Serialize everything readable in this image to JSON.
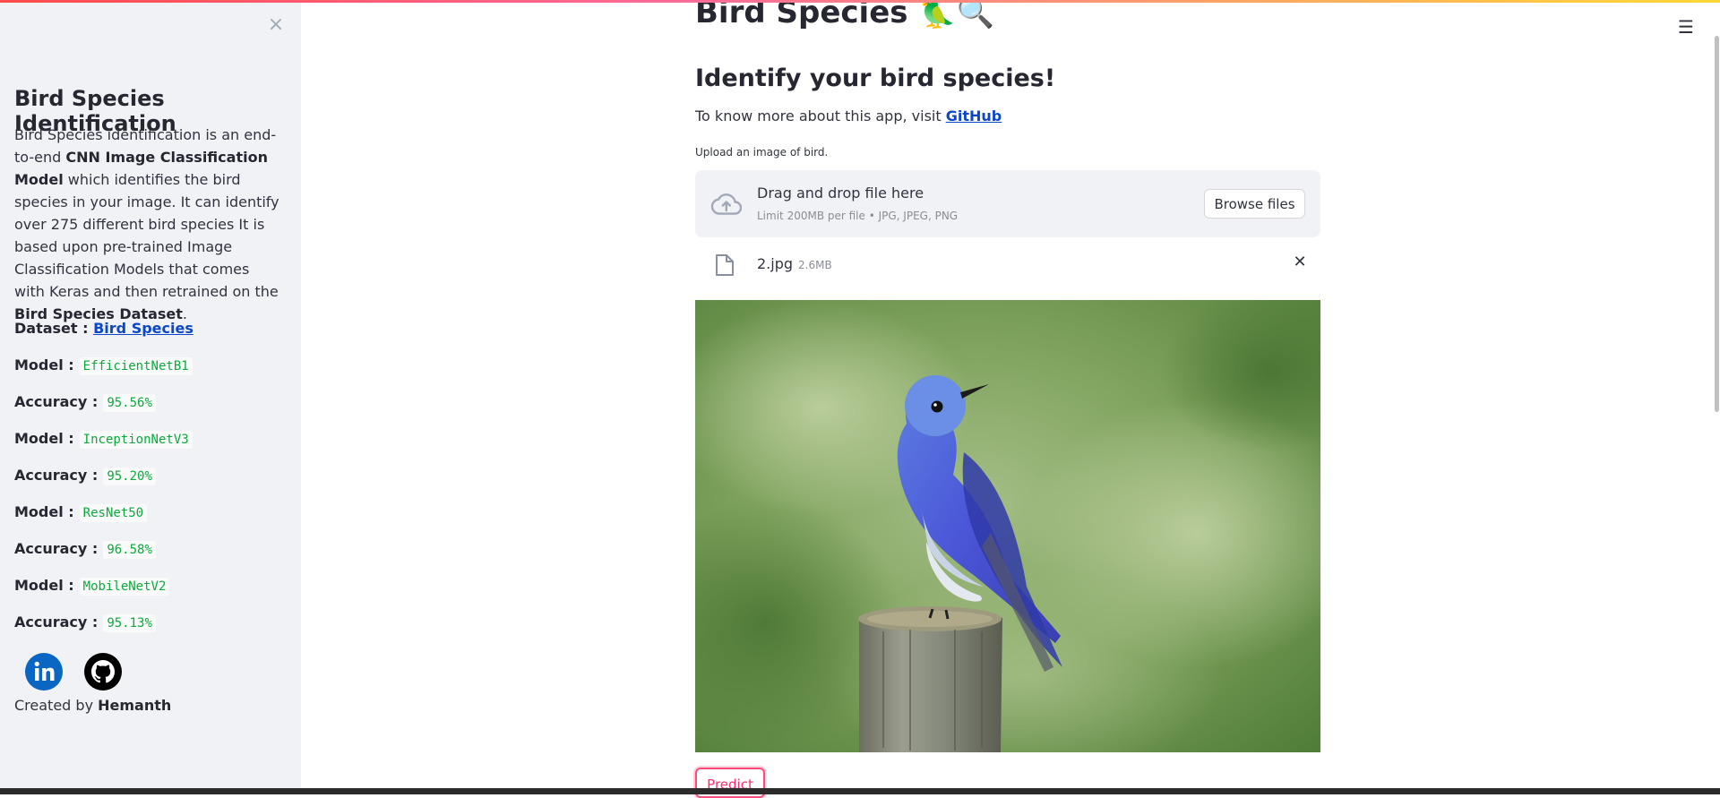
{
  "sidebar": {
    "close_label": "×",
    "title": "Bird Species Identification",
    "description_parts": {
      "p1": "Bird Species identification is an end-to-end ",
      "b1": "CNN Image Classification Model",
      "p2": " which identifies the bird species in your image. It can identify over 275 different bird species It is based upon pre-trained Image Classification Models that comes with Keras and then retrained on the ",
      "b2": "Bird Species Dataset",
      "p3": "."
    },
    "dataset_label": "Dataset :",
    "dataset_link": "Bird Species",
    "models": [
      {
        "model_label": "Model :",
        "model": "EfficientNetB1",
        "acc_label": "Accuracy :",
        "accuracy": "95.56%"
      },
      {
        "model_label": "Model :",
        "model": "InceptionNetV3",
        "acc_label": "Accuracy :",
        "accuracy": "95.20%"
      },
      {
        "model_label": "Model :",
        "model": "ResNet50",
        "acc_label": "Accuracy :",
        "accuracy": "96.58%"
      },
      {
        "model_label": "Model :",
        "model": "MobileNetV2",
        "acc_label": "Accuracy :",
        "accuracy": "95.13%"
      }
    ],
    "created_prefix": "Created by ",
    "created_name": "Hemanth",
    "linkedin_color": "#0a66c2",
    "github_color": "#000000"
  },
  "header": {
    "menu_icon": "hamburger-menu-icon"
  },
  "main": {
    "title": "Bird Species 🦜🔍",
    "subheading": "Identify your bird species!",
    "info_prefix": "To know more about this app, visit ",
    "info_link": "GitHub",
    "upload_label": "Upload an image of bird.",
    "dropzone": {
      "title": "Drag and drop file here",
      "limit": "Limit 200MB per file • JPG, JPEG, PNG",
      "browse_label": "Browse files"
    },
    "file": {
      "name": "2.jpg",
      "size": "2.6MB",
      "remove_label": "✕"
    },
    "predict_label": "Predict"
  },
  "colors": {
    "sidebar_bg": "#f0f2f6",
    "accent": "#ff4b4b",
    "link": "#0d47c9",
    "code_green": "#09ab3b"
  }
}
